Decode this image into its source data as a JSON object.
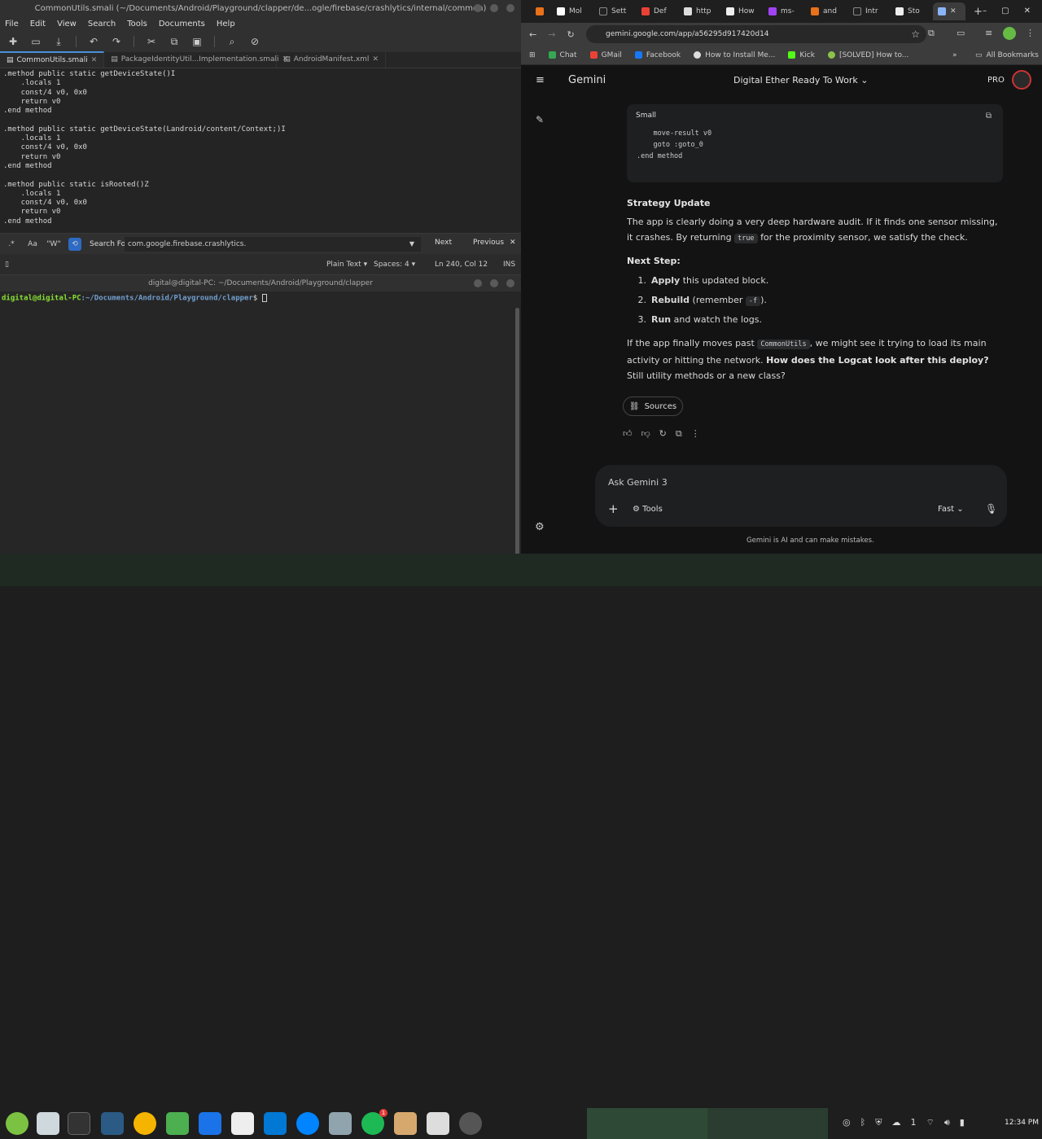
{
  "editor": {
    "title": "CommonUtils.smali (~/Documents/Android/Playground/clapper/de...ogle/firebase/crashlytics/internal/common)",
    "menu": [
      "File",
      "Edit",
      "View",
      "Search",
      "Tools",
      "Documents",
      "Help"
    ],
    "tabs": [
      {
        "label": "CommonUtils.smali"
      },
      {
        "label": "PackageIdentityUtil...Implementation.smali"
      },
      {
        "label": "AndroidManifest.xml"
      }
    ],
    "code": ".method public static getDeviceState()I\n    .locals 1\n    const/4 v0, 0x0\n    return v0\n.end method\n\n.method public static getDeviceState(Landroid/content/Context;)I\n    .locals 1\n    const/4 v0, 0x0\n    return v0\n.end method\n\n.method public static isRooted()Z\n    .locals 1\n    const/4 v0, 0x0\n    return v0\n.end method",
    "search": {
      "label": "Search For:",
      "value": "com.google.firebase.crashlytics.",
      "next": "Next",
      "previous": "Previous",
      "opt_regex": ".*",
      "opt_case": "Aa",
      "opt_word": "\"W\""
    },
    "status": {
      "syntax": "Plain Text",
      "spaces": "Spaces: 4",
      "position": "Ln 240, Col 12",
      "mode": "INS"
    }
  },
  "terminal": {
    "title": "digital@digital-PC: ~/Documents/Android/Playground/clapper",
    "user": "digital@digital-PC",
    "path": ":~/Documents/Android/Playground/clapper",
    "symbol": "$"
  },
  "browser": {
    "tabs": [
      {
        "label": "",
        "color": "#e8711a"
      },
      {
        "label": "Mol",
        "color": "#ffffff"
      },
      {
        "label": "Sett",
        "color": "#222222"
      },
      {
        "label": "Def",
        "color": "#e94235"
      },
      {
        "label": "http",
        "color": "#dddddd"
      },
      {
        "label": "How",
        "color": "#eeeeee"
      },
      {
        "label": "ms-",
        "color": "#a142f4"
      },
      {
        "label": "and",
        "color": "#e8711a"
      },
      {
        "label": "Intr",
        "color": "#222222"
      },
      {
        "label": "Sto",
        "color": "#eeeeee"
      },
      {
        "label": "",
        "color": "#8ab4f8"
      }
    ],
    "url": "gemini.google.com/app/a56295d917420d14",
    "bookmarks": [
      {
        "label": "Chat",
        "color": "#34a853"
      },
      {
        "label": "GMail",
        "color": "#ea4335"
      },
      {
        "label": "Facebook",
        "color": "#1877f2"
      },
      {
        "label": "How to Install Me...",
        "color": "#dddddd"
      },
      {
        "label": "Kick",
        "color": "#53fc18"
      },
      {
        "label": "[SOLVED] How to...",
        "color": "#8bc34a"
      }
    ],
    "all_bookmarks": "All Bookmarks"
  },
  "gemini": {
    "brand": "Gemini",
    "chat_title": "Digital Ether Ready To Work",
    "pro": "PRO",
    "code_lang": "Small",
    "code_lines": [
      "    move-result v0",
      "    goto :goto_0",
      ".end method"
    ],
    "heading": "Strategy Update",
    "para1": "The app is clearly doing a very deep hardware audit. If it finds one sensor missing, it crashes. By returning",
    "para1_code": "true",
    "para1_end": "for the proximity sensor, we satisfy the check.",
    "next_heading": "Next Step:",
    "steps": [
      {
        "num": "1.",
        "bold": "Apply",
        "rest": " this updated block.",
        "code": ""
      },
      {
        "num": "2.",
        "bold": "Rebuild",
        "rest": " (remember ",
        "code": "-f",
        "end": ")."
      },
      {
        "num": "3.",
        "bold": "Run",
        "rest": " and watch the logs.",
        "code": ""
      }
    ],
    "para2_a": "If the app finally moves past",
    "para2_code": "CommonUtils",
    "para2_b": ", we might see it trying to load its main activity or hitting the network.",
    "para2_bold": "How does the Logcat look after this deploy?",
    "para2_c": "Still utility methods or a new class?",
    "sources": "Sources",
    "input_placeholder": "Ask Gemini 3",
    "tools": "Tools",
    "mode": "Fast",
    "disclaimer": "Gemini is AI and can make mistakes."
  },
  "taskbar": {
    "time": "12:34 PM",
    "badge_count": "1",
    "badge_spotify": "1"
  }
}
